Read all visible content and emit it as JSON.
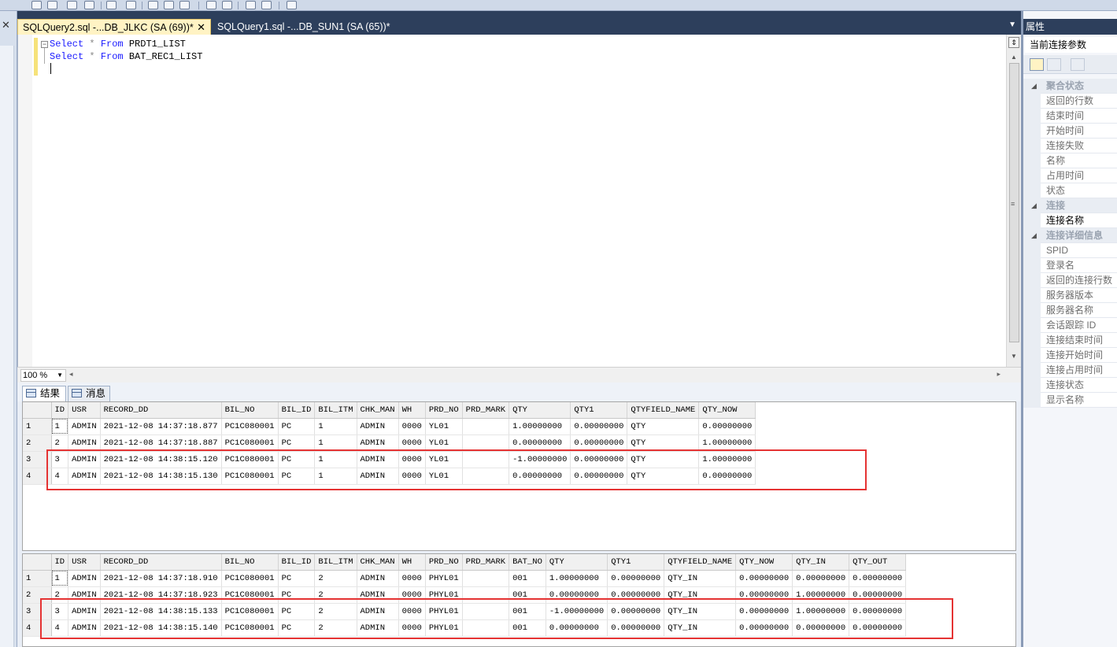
{
  "tabs": [
    {
      "label": "SQLQuery2.sql -...DB_JLKC (SA (69))*",
      "active": true
    },
    {
      "label": "SQLQuery1.sql -...DB_SUN1 (SA (65))*",
      "active": false
    }
  ],
  "editor": {
    "line1": {
      "kw1": "Select",
      "op": "*",
      "kw2": "From",
      "table": "PRDT1_LIST"
    },
    "line2": {
      "kw1": "Select",
      "op": "*",
      "kw2": "From",
      "table": "BAT_REC1_LIST"
    }
  },
  "zoom": "100 %",
  "result_tabs": {
    "results": "结果",
    "messages": "消息"
  },
  "grid1": {
    "columns": [
      "ID",
      "USR",
      "RECORD_DD",
      "BIL_NO",
      "BIL_ID",
      "BIL_ITM",
      "CHK_MAN",
      "WH",
      "PRD_NO",
      "PRD_MARK",
      "QTY",
      "QTY1",
      "QTYFIELD_NAME",
      "QTY_NOW"
    ],
    "rows": [
      [
        "1",
        "ADMIN",
        "2021-12-08 14:37:18.877",
        "PC1C080001",
        "PC",
        "1",
        "ADMIN",
        "0000",
        "YL01",
        "",
        "1.00000000",
        "0.00000000",
        "QTY",
        "0.00000000"
      ],
      [
        "2",
        "ADMIN",
        "2021-12-08 14:37:18.887",
        "PC1C080001",
        "PC",
        "1",
        "ADMIN",
        "0000",
        "YL01",
        "",
        "0.00000000",
        "0.00000000",
        "QTY",
        "1.00000000"
      ],
      [
        "3",
        "ADMIN",
        "2021-12-08 14:38:15.120",
        "PC1C080001",
        "PC",
        "1",
        "ADMIN",
        "0000",
        "YL01",
        "",
        "-1.00000000",
        "0.00000000",
        "QTY",
        "1.00000000"
      ],
      [
        "4",
        "ADMIN",
        "2021-12-08 14:38:15.130",
        "PC1C080001",
        "PC",
        "1",
        "ADMIN",
        "0000",
        "YL01",
        "",
        "0.00000000",
        "0.00000000",
        "QTY",
        "0.00000000"
      ]
    ]
  },
  "grid2": {
    "columns": [
      "ID",
      "USR",
      "RECORD_DD",
      "BIL_NO",
      "BIL_ID",
      "BIL_ITM",
      "CHK_MAN",
      "WH",
      "PRD_NO",
      "PRD_MARK",
      "BAT_NO",
      "QTY",
      "QTY1",
      "QTYFIELD_NAME",
      "QTY_NOW",
      "QTY_IN",
      "QTY_OUT"
    ],
    "rows": [
      [
        "1",
        "ADMIN",
        "2021-12-08 14:37:18.910",
        "PC1C080001",
        "PC",
        "2",
        "ADMIN",
        "0000",
        "PHYL01",
        "",
        "001",
        "1.00000000",
        "0.00000000",
        "QTY_IN",
        "0.00000000",
        "0.00000000",
        "0.00000000"
      ],
      [
        "2",
        "ADMIN",
        "2021-12-08 14:37:18.923",
        "PC1C080001",
        "PC",
        "2",
        "ADMIN",
        "0000",
        "PHYL01",
        "",
        "001",
        "0.00000000",
        "0.00000000",
        "QTY_IN",
        "0.00000000",
        "1.00000000",
        "0.00000000"
      ],
      [
        "3",
        "ADMIN",
        "2021-12-08 14:38:15.133",
        "PC1C080001",
        "PC",
        "2",
        "ADMIN",
        "0000",
        "PHYL01",
        "",
        "001",
        "-1.00000000",
        "0.00000000",
        "QTY_IN",
        "0.00000000",
        "1.00000000",
        "0.00000000"
      ],
      [
        "4",
        "ADMIN",
        "2021-12-08 14:38:15.140",
        "PC1C080001",
        "PC",
        "2",
        "ADMIN",
        "0000",
        "PHYL01",
        "",
        "001",
        "0.00000000",
        "0.00000000",
        "QTY_IN",
        "0.00000000",
        "0.00000000",
        "0.00000000"
      ]
    ]
  },
  "properties": {
    "title": "属性",
    "combo": "当前连接参数",
    "items": [
      {
        "label": "聚合状态",
        "category": true
      },
      {
        "label": "返回的行数"
      },
      {
        "label": "结束时间"
      },
      {
        "label": "开始时间"
      },
      {
        "label": "连接失败"
      },
      {
        "label": "名称"
      },
      {
        "label": "占用时间"
      },
      {
        "label": "状态"
      },
      {
        "label": "连接",
        "category": true
      },
      {
        "label": "连接名称",
        "dark": true
      },
      {
        "label": "连接详细信息",
        "category": true
      },
      {
        "label": "SPID"
      },
      {
        "label": "登录名"
      },
      {
        "label": "返回的连接行数"
      },
      {
        "label": "服务器版本"
      },
      {
        "label": "服务器名称"
      },
      {
        "label": "会话跟踪 ID"
      },
      {
        "label": "连接结束时间"
      },
      {
        "label": "连接开始时间"
      },
      {
        "label": "连接占用时间"
      },
      {
        "label": "连接状态"
      },
      {
        "label": "显示名称"
      }
    ]
  },
  "colors": {
    "highlight": "#e53333",
    "tab_active": "#fff3c4",
    "keyword": "#1a1aff",
    "title_bar": "#2d3f5c"
  }
}
